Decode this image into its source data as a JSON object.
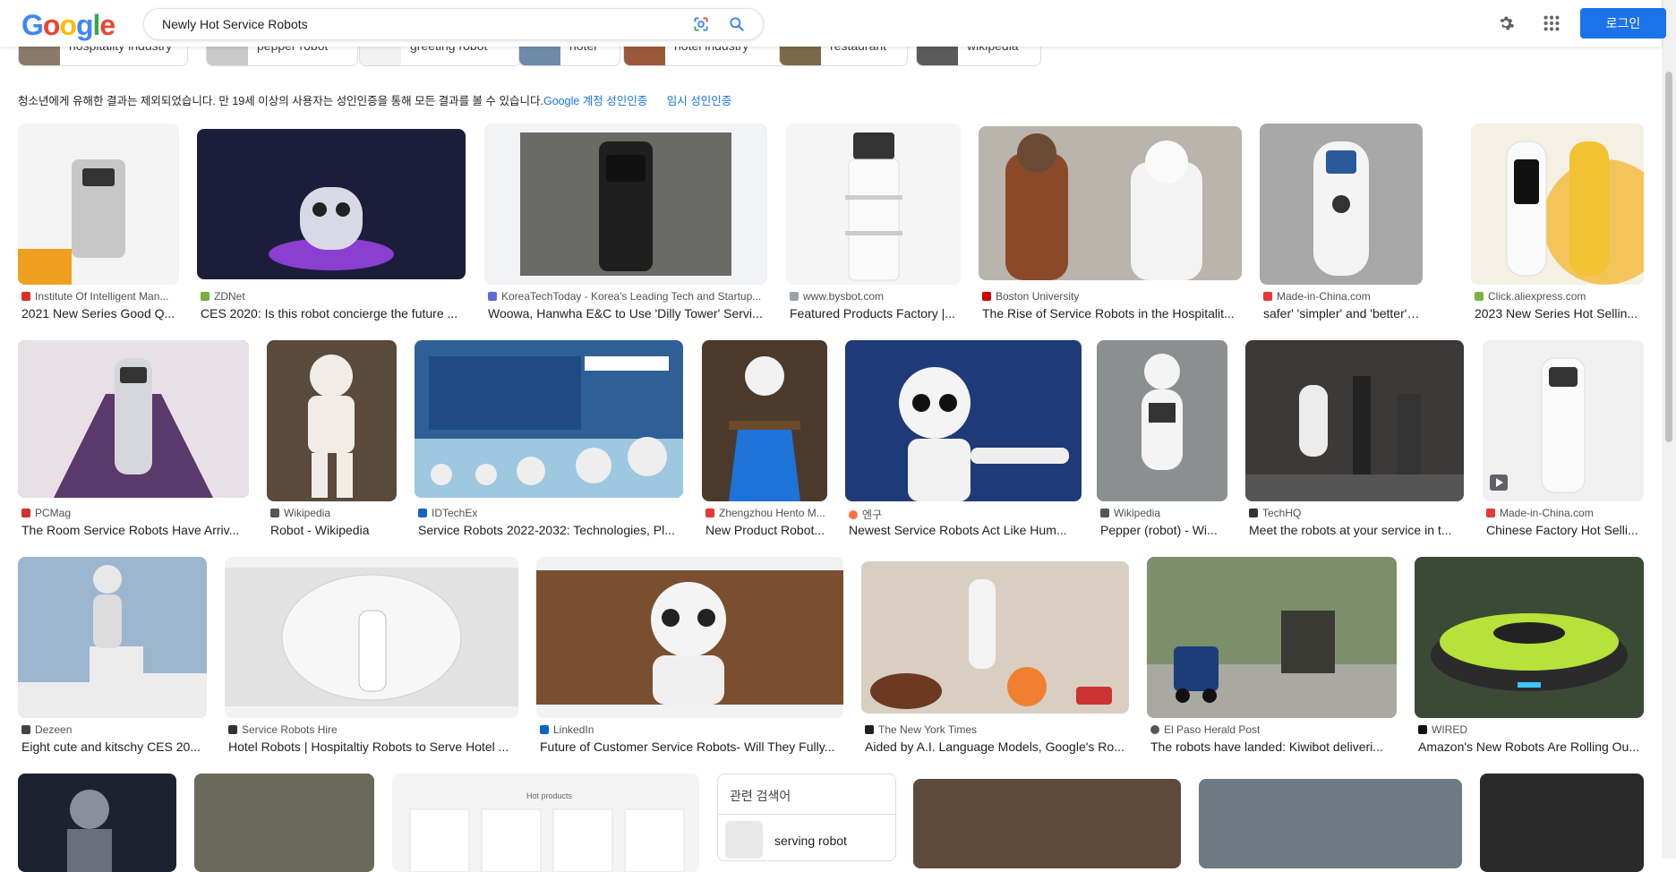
{
  "header": {
    "logo_letters": [
      "G",
      "o",
      "o",
      "g",
      "l",
      "e"
    ],
    "logo_colors": [
      "#4285F4",
      "#EA4335",
      "#FBBC05",
      "#4285F4",
      "#34A853",
      "#EA4335"
    ],
    "query": "Newly Hot Service Robots",
    "login_label": "로그인",
    "icons": [
      "google-lens-icon",
      "search-icon",
      "gear-icon",
      "apps-grid-icon"
    ]
  },
  "chips": [
    {
      "label": "hospitality industry"
    },
    {
      "label": "pepper robot"
    },
    {
      "label": "greeting robot"
    },
    {
      "label": "hotel"
    },
    {
      "label": "hotel industry"
    },
    {
      "label": "restaurant"
    },
    {
      "label": "wikipedia"
    }
  ],
  "notice": {
    "text": "청소년에게 유해한 결과는 제외되었습니다. 만 19세 이상의 사용자는 성인인증을 통해 모든 결과를 볼 수 있습니다.",
    "link1": "Google 계정 성인인증",
    "link2": "임시 성인인증"
  },
  "results": [
    {
      "source": "Institute Of Intelligent Man...",
      "title": "2021 New Series Good Q...",
      "fav": "#d93025",
      "bg": "#f4f4f4"
    },
    {
      "source": "ZDNet",
      "title": "CES 2020: Is this robot concierge the future ...",
      "fav": "#76b041",
      "bg": "#1b1d3a"
    },
    {
      "source": "KoreaTechToday - Korea's Leading Tech and Startup...",
      "title": "Woowa, Hanwha E&C to Use 'Dilly Tower' Servi...",
      "fav": "#5f6bd6",
      "bg": "#6a6a66"
    },
    {
      "source": "www.bysbot.com",
      "title": "Featured Products Factory |...",
      "fav": "#9aa0a6",
      "bg": "#f5f5f5"
    },
    {
      "source": "Boston University",
      "title": "The Rise of Service Robots in the Hospitalit...",
      "fav": "#cc0000",
      "bg": "#b9b4ac"
    },
    {
      "source": "Made-in-China.com",
      "title": "safer' 'simpler' and 'better' intel...",
      "fav": "#e53935",
      "bg": "#a8a8a8"
    },
    {
      "source": "Click.aliexpress.com",
      "title": "2023 New Series Hot Sellin...",
      "fav": "#7cb342",
      "bg": "#f5f0e4"
    },
    {
      "source": "PCMag",
      "title": "The Room Service Robots Have Arriv...",
      "fav": "#d32f2f",
      "bg": "#6b4e73"
    },
    {
      "source": "Wikipedia",
      "title": "Robot - Wikipedia",
      "fav": "#555555",
      "bg": "#5a4a3c"
    },
    {
      "source": "IDTechEx",
      "title": "Service Robots 2022-2032: Technologies, Pl...",
      "fav": "#1565c0",
      "bg": "#2e5f96"
    },
    {
      "source": "Zhengzhou Hento M...",
      "title": "New Product Robot...",
      "fav": "#e53935",
      "bg": "#4b3a2c"
    },
    {
      "source": "엔구",
      "title": "Newest Service Robots Act Like Hum...",
      "fav": "#ff7043",
      "bg": "#1f3a78"
    },
    {
      "source": "Wikipedia",
      "title": "Pepper (robot) - Wi...",
      "fav": "#555555",
      "bg": "#8b8f8f"
    },
    {
      "source": "TechHQ",
      "title": "Meet the robots at your service in t...",
      "fav": "#333333",
      "bg": "#3c3a38"
    },
    {
      "source": "Made-in-China.com",
      "title": "Chinese Factory Hot Selli...",
      "fav": "#e53935",
      "bg": "#f0f0f0"
    },
    {
      "source": "Dezeen",
      "title": "Eight cute and kitschy CES 20...",
      "fav": "#444444",
      "bg": "#9db6cf"
    },
    {
      "source": "Service Robots Hire",
      "title": "Hotel Robots | Hospitaltiy Robots to Serve Hotel ...",
      "fav": "#333333",
      "bg": "#e2e2e2"
    },
    {
      "source": "LinkedIn",
      "title": "Future of Customer Service Robots- Will They Fully...",
      "fav": "#0a66c2",
      "bg": "#7a4f30"
    },
    {
      "source": "The New York Times",
      "title": "Aided by A.I. Language Models, Google's Ro...",
      "fav": "#222222",
      "bg": "#d8cfc2"
    },
    {
      "source": "El Paso Herald Post",
      "title": "The robots have landed: Kiwibot deliveri...",
      "fav": "#555555",
      "bg": "#7c8f6a"
    },
    {
      "source": "WIRED",
      "title": "Amazon's New Robots Are Rolling Ou...",
      "fav": "#111111",
      "bg": "#3b4a34"
    }
  ],
  "bottom_row": [
    {
      "bg": "#1c2230"
    },
    {
      "bg": "#6b6a5a"
    },
    {
      "bg": "#f4f4f4",
      "label": "Hot products"
    },
    {
      "bg": "#5e4a3a"
    },
    {
      "bg": "#6d7a84"
    },
    {
      "bg": "#2a2a2a"
    }
  ],
  "related": {
    "heading": "관련 검색어",
    "item": "serving robot"
  }
}
